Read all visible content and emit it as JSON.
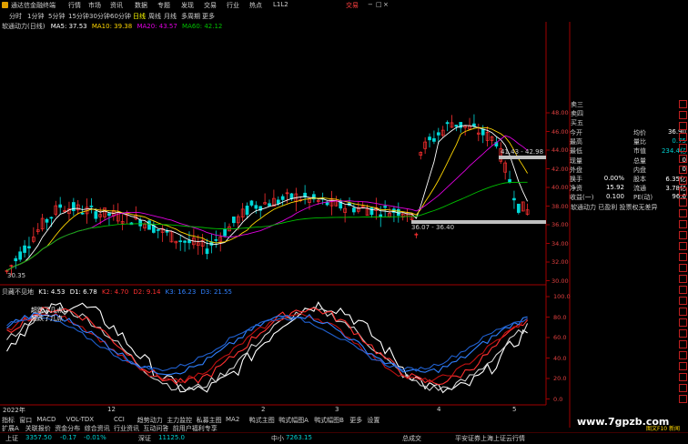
{
  "titlebar": {
    "app": "通达信金融终端",
    "menus": [
      "行情",
      "市场",
      "资讯",
      "数据",
      "专题",
      "发现",
      "交易",
      "行业",
      "热点",
      "L1L2"
    ],
    "broker": "交易",
    "win_controls": [
      "−",
      "□",
      "×"
    ]
  },
  "period_bar": {
    "items": [
      "分时",
      "1分钟",
      "5分钟",
      "15分钟",
      "30分钟",
      "60分钟",
      "日线",
      "周线",
      "月线",
      "多周期",
      "更多"
    ],
    "active": "日线"
  },
  "main_indicator": {
    "title": "软通动力(日线)",
    "ma5": "MA5: 37.53",
    "ma10": "MA10: 39.38",
    "ma20": "MA20: 43.57",
    "ma60": "MA60: 42.12"
  },
  "sub_indicator": {
    "title": "贝藏不见地",
    "k1": "K1: 4.53",
    "d1": "D1: 6.78",
    "k2": "K2: 4.70",
    "d2": "D2: 9.14",
    "k3": "K3: 16.23",
    "d3": "D3: 21.55"
  },
  "price_axis": [
    "48.00",
    "46.00",
    "44.00",
    "42.00",
    "40.00",
    "38.00",
    "36.00",
    "34.00",
    "32.00",
    "30.00"
  ],
  "osc_axis": [
    "100.0",
    "80.0",
    "60.0",
    "40.0",
    "20.0",
    "0.0"
  ],
  "chart_annotations": {
    "low_label": "30.35",
    "range_label_1": "36.07 - 36.40",
    "range_label_2": "41.43 - 42.98",
    "osc_note_1": "超跌了几点",
    "osc_note_2": "超跌了几点"
  },
  "x_labels": [
    "2022年",
    "12",
    "2",
    "3",
    "4",
    "5"
  ],
  "right_panel": {
    "order_book_labels": [
      "卖三",
      "卖四",
      "买五"
    ],
    "stats": [
      {
        "l": "今开",
        "v": "",
        "l2": "均价",
        "v2": "36.90"
      },
      {
        "l": "最高",
        "v": "",
        "l2": "量比",
        "v2": "0.75"
      },
      {
        "l": "最低",
        "v": "",
        "l2": "市值",
        "v2": "234.4亿"
      },
      {
        "l": "现量",
        "v": "",
        "l2": "总量",
        "v2": "0"
      },
      {
        "l": "外盘",
        "v": "",
        "l2": "内盘",
        "v2": "0"
      },
      {
        "l": "换手",
        "v": "0.00%",
        "l2": "股本",
        "v2": "6.35亿"
      },
      {
        "l": "净资",
        "v": "15.92",
        "l2": "流通",
        "v2": "3.78亿"
      },
      {
        "l": "收益(一)",
        "v": "0.100",
        "l2": "PE(动)",
        "v2": "96.6"
      }
    ],
    "stock_note": "软通动力 已盈利 投票权无差异"
  },
  "bottom_tabs": [
    "指标",
    "窗口",
    "MACD",
    "VOL-TDX",
    "CCI",
    "趋势动力",
    "主力监控",
    "私募主图",
    "MA2",
    "鸭式主图",
    "鸭式幅图A",
    "鸭式幅图B",
    "更多",
    "设置"
  ],
  "sub_tabs": [
    "扩展A",
    "关联报价",
    "资金分布",
    "综合资讯",
    "行业资讯",
    "互动问答",
    "前用户福利专享"
  ],
  "status": {
    "sh_label": "上证",
    "sh_value": "3357.50",
    "sh_chg": "-0.17",
    "sh_pct": "-0.01%",
    "sz_label": "深证",
    "sz_value": "11125.0",
    "zx_label": "中小",
    "zx_value": "7263.15",
    "zc_label": "总成交",
    "news": "平安证券上海上证云行情",
    "right": "图文F10 新闻"
  },
  "watermark": "www.7gpzb.com",
  "colors": {
    "up": "#ff3030",
    "down": "#00d8d8",
    "ma5": "#ffffff",
    "ma10": "#ffd700",
    "ma20": "#e000e0",
    "ma60": "#00c000"
  }
}
